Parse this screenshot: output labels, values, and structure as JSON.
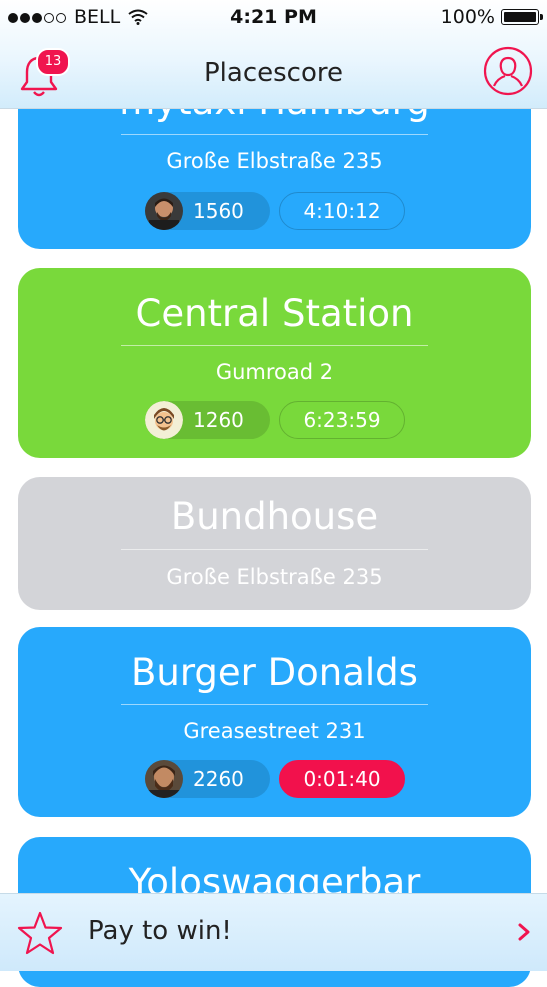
{
  "status_bar": {
    "carrier": "BELL",
    "time": "4:21 PM",
    "battery": "100%"
  },
  "nav": {
    "title": "Placescore",
    "notification_count": "13"
  },
  "places": [
    {
      "name": "mytaxi Hamburg",
      "address": "Große Elbstraße 235",
      "score": "1560",
      "timer": "4:10:12",
      "color": "blue",
      "avatar": "avatar-man-beard-photo"
    },
    {
      "name": "Central Station",
      "address": "Gumroad 2",
      "score": "1260",
      "timer": "6:23:59",
      "color": "green",
      "avatar": "avatar-cartoon-glasses"
    },
    {
      "name": "Bundhouse",
      "address": "Große Elbstraße 235",
      "color": "gray"
    },
    {
      "name": "Burger Donalds",
      "address": "Greasestreet 231",
      "score": "2260",
      "timer": "0:01:40",
      "color": "blue",
      "timer_alert": true,
      "avatar": "avatar-man-beard-photo-2"
    },
    {
      "name": "Yoloswaggerbar",
      "color": "blue"
    }
  ],
  "bottom_bar": {
    "label": "Pay to win!"
  },
  "colors": {
    "blue": "#27a9fc",
    "green": "#79d93b",
    "gray": "#d3d4d8",
    "accent": "#f0154f"
  }
}
